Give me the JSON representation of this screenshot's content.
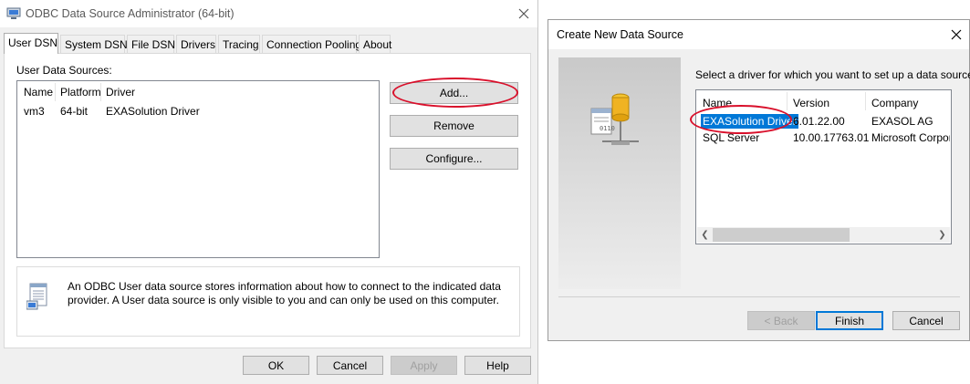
{
  "odbc": {
    "title": "ODBC Data Source Administrator (64-bit)",
    "tabs": [
      "User DSN",
      "System DSN",
      "File DSN",
      "Drivers",
      "Tracing",
      "Connection Pooling",
      "About"
    ],
    "list_label": "User Data Sources:",
    "columns": [
      "Name",
      "Platform",
      "Driver"
    ],
    "rows": [
      {
        "name": "vm3",
        "platform": "64-bit",
        "driver": "EXASolution Driver"
      }
    ],
    "buttons": {
      "add": "Add...",
      "remove": "Remove",
      "configure": "Configure..."
    },
    "info": "An ODBC User data source stores information about how to connect to the indicated data provider.   A User data source is only visible to you and can only be used on this computer.",
    "footer": {
      "ok": "OK",
      "cancel": "Cancel",
      "apply": "Apply",
      "help": "Help"
    }
  },
  "create": {
    "title": "Create New Data Source",
    "prompt": "Select a driver for which you want to set up a data source.",
    "columns": [
      "Name",
      "Version",
      "Company"
    ],
    "rows": [
      {
        "name": "EXASolution Driver",
        "version": "6.01.22.00",
        "company": "EXASOL AG",
        "selected": true
      },
      {
        "name": "SQL Server",
        "version": "10.00.17763.01",
        "company": "Microsoft Corporat",
        "selected": false
      }
    ],
    "buttons": {
      "back": "< Back",
      "finish": "Finish",
      "cancel": "Cancel"
    }
  },
  "colors": {
    "selection": "#0078d7",
    "highlight_ellipse": "#d9102b",
    "accent_blue": "#0078d7"
  },
  "icons": [
    "odbc-app-icon",
    "close-icon",
    "data-source-icon",
    "database-wizard-icon",
    "scroll-left-icon",
    "scroll-right-icon"
  ]
}
